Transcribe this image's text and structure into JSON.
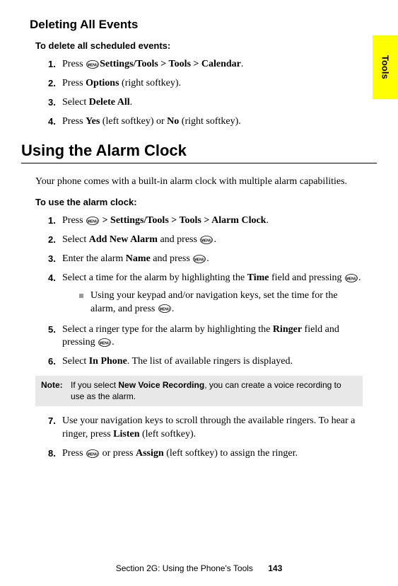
{
  "side_tab": "Tools",
  "section1": {
    "heading": "Deleting All Events",
    "intro": "To delete all scheduled events:",
    "steps": [
      {
        "num": "1.",
        "parts": [
          "Press ",
          "OK",
          " > ",
          "Settings/Tools > Tools > Calendar",
          "."
        ]
      },
      {
        "num": "2.",
        "parts": [
          "Press ",
          "",
          "",
          "Options",
          " (right softkey)."
        ]
      },
      {
        "num": "3.",
        "parts": [
          "Select ",
          "",
          "",
          "Delete All",
          "."
        ]
      },
      {
        "num": "4.",
        "parts": [
          "Press ",
          "",
          "",
          "Yes",
          " (left softkey) or ",
          "No",
          " (right softkey)."
        ]
      }
    ]
  },
  "section2": {
    "heading": "Using the Alarm Clock",
    "body": "Your phone comes with a built-in alarm clock with multiple alarm capabilities.",
    "intro": "To use the alarm clock:",
    "steps": {
      "s1": {
        "num": "1.",
        "pre": "Press ",
        "bold": " > Settings/Tools > Tools > Alarm Clock",
        "post": "."
      },
      "s2": {
        "num": "2.",
        "pre": "Select ",
        "bold": "Add New Alarm",
        "mid": " and press ",
        "post": "."
      },
      "s3": {
        "num": "3.",
        "pre": "Enter the alarm ",
        "bold": "Name",
        "mid": " and press ",
        "post": "."
      },
      "s4": {
        "num": "4.",
        "pre": "Select a time for the alarm by highlighting the ",
        "bold": "Time",
        "mid": " field and pressing ",
        "post": "."
      },
      "s4sub": {
        "pre": "Using your keypad and/or navigation keys, set the time for the alarm, and press ",
        "post": "."
      },
      "s5": {
        "num": "5.",
        "pre": "Select a ringer type for the alarm by highlighting the ",
        "bold": "Ringer",
        "mid": " field and pressing ",
        "post": "."
      },
      "s6": {
        "num": "6.",
        "pre": "Select ",
        "bold": "In Phone",
        "post": ". The list of available ringers is displayed."
      },
      "s7": {
        "num": "7.",
        "pre": "Use your navigation keys to scroll through the available ringers. To hear a ringer, press ",
        "bold": "Listen",
        "post": " (left softkey)."
      },
      "s8": {
        "num": "8.",
        "pre": "Press ",
        "mid": " or press ",
        "bold": "Assign",
        "post": " (left softkey) to assign the ringer."
      }
    }
  },
  "note": {
    "label": "Note:",
    "text_pre": "If you select ",
    "text_bold": "New Voice Recording",
    "text_post": ", you can create a voice recording to use as the alarm."
  },
  "footer": {
    "section": "Section 2G: Using the Phone's Tools",
    "page": "143"
  }
}
